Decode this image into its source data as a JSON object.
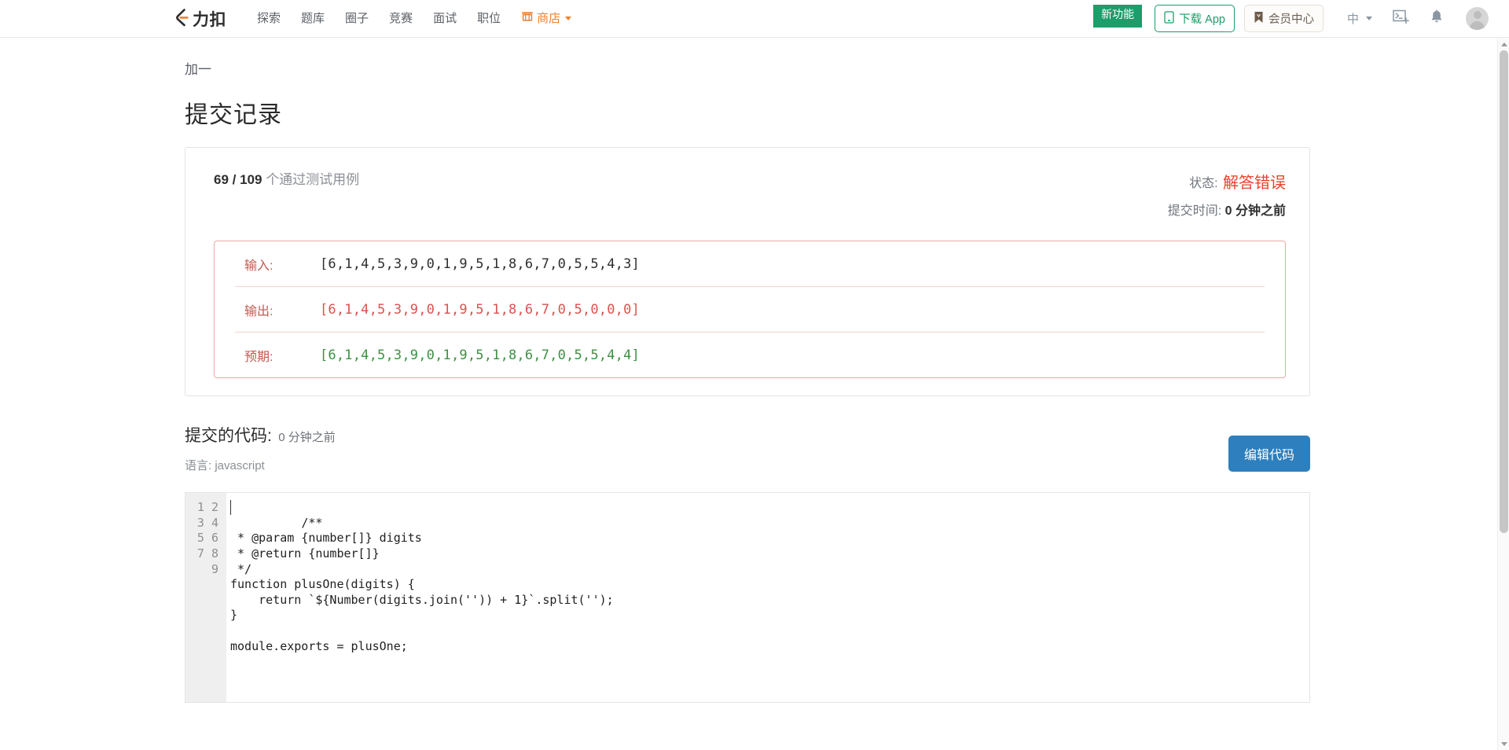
{
  "nav": {
    "brand_text": "力扣",
    "brand_icon": "leetcode-logo-icon",
    "links": [
      {
        "label": "探索"
      },
      {
        "label": "题库"
      },
      {
        "label": "圈子"
      },
      {
        "label": "竞赛"
      },
      {
        "label": "面试"
      },
      {
        "label": "职位"
      }
    ],
    "store_label": "商店",
    "store_icon": "store-icon",
    "ribbon_label": "新功能",
    "download_label": "下载 App",
    "download_icon": "mobile-icon",
    "member_label": "会员中心",
    "member_icon": "bookmark-icon",
    "language_label": "中",
    "console_icon": "terminal-plus-icon",
    "bell_icon": "notification-bell-icon",
    "avatar_icon": "user-avatar"
  },
  "breadcrumb": "加一",
  "page_title": "提交记录",
  "result": {
    "passed_count": "69 / 109",
    "passed_suffix": "个通过测试用例",
    "status_label": "状态:",
    "status_value": "解答错误",
    "status_color": "#e8422f",
    "time_label": "提交时间:",
    "time_value": "0 分钟之前",
    "testcases": [
      {
        "label": "输入:",
        "value": "[6,1,4,5,3,9,0,1,9,5,1,8,6,7,0,5,5,4,3]",
        "tone": "dark"
      },
      {
        "label": "输出:",
        "value": "[6,1,4,5,3,9,0,1,9,5,1,8,6,7,0,5,0,0,0]",
        "tone": "wrong"
      },
      {
        "label": "预期:",
        "value": "[6,1,4,5,3,9,0,1,9,5,1,8,6,7,0,5,5,4,4]",
        "tone": "ok"
      }
    ]
  },
  "code_section": {
    "title": "提交的代码:",
    "time": "0 分钟之前",
    "language_label": "语言:",
    "language_value": "javascript",
    "edit_button": "编辑代码",
    "line_numbers": "1\n2\n3\n4\n5\n6\n7\n8\n9",
    "source": "/**\n * @param {number[]} digits\n * @return {number[]}\n */\nfunction plusOne(digits) {\n    return `${Number(digits.join('')) + 1}`.split('');\n}\n\nmodule.exports = plusOne;"
  }
}
